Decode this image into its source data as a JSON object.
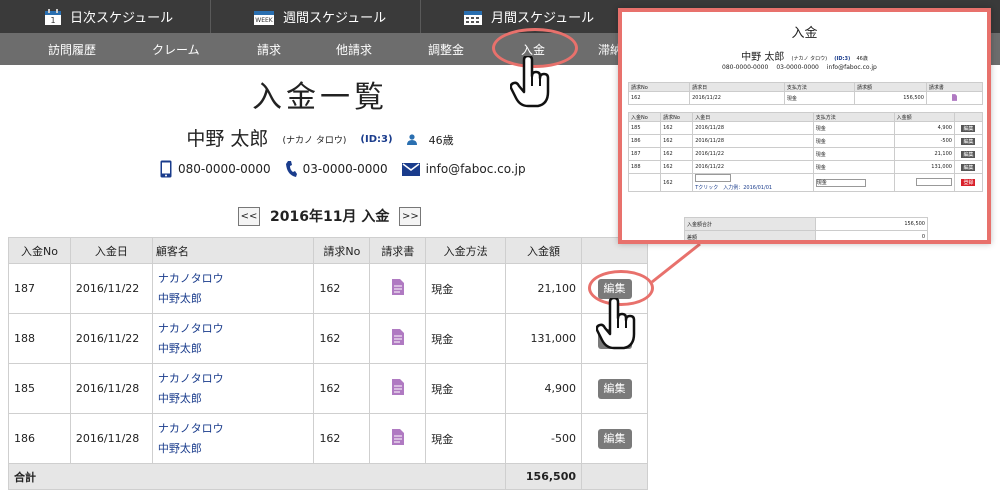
{
  "topbar": {
    "daily": "日次スケジュール",
    "weekly": "週間スケジュール",
    "monthly": "月間スケジュール",
    "weekly_icon_text": "WEEK",
    "daily_icon_text": "1"
  },
  "subnav": [
    "訪問履歴",
    "クレーム",
    "請求",
    "他請求",
    "調整金",
    "入金",
    "滞納"
  ],
  "page": {
    "title": "入金一覧",
    "name": "中野 太郎",
    "kana": "(ナカノ タロウ)",
    "id": "(ID:3)",
    "age": "46歳",
    "mobile": "080-0000-0000",
    "phone": "03-0000-0000",
    "email": "info@faboc.co.jp",
    "month": "2016年11月 入金",
    "prev": "<<",
    "next": ">>"
  },
  "table": {
    "headers": [
      "入金No",
      "入金日",
      "顧客名",
      "請求No",
      "請求書",
      "入金方法",
      "入金額",
      ""
    ],
    "rows": [
      {
        "no": "187",
        "date": "2016/11/22",
        "kana": "ナカノタロウ",
        "name": "中野太郎",
        "bill": "162",
        "method": "現金",
        "amount": "21,100",
        "edit": "編集"
      },
      {
        "no": "188",
        "date": "2016/11/22",
        "kana": "ナカノタロウ",
        "name": "中野太郎",
        "bill": "162",
        "method": "現金",
        "amount": "131,000",
        "edit": "編集"
      },
      {
        "no": "185",
        "date": "2016/11/28",
        "kana": "ナカノタロウ",
        "name": "中野太郎",
        "bill": "162",
        "method": "現金",
        "amount": "4,900",
        "edit": "編集"
      },
      {
        "no": "186",
        "date": "2016/11/28",
        "kana": "ナカノタロウ",
        "name": "中野太郎",
        "bill": "162",
        "method": "現金",
        "amount": "-500",
        "edit": "編集"
      }
    ],
    "total_label": "合計",
    "total_value": "156,500"
  },
  "inset": {
    "title": "入金",
    "name": "中野 太郎",
    "kana": "(ナカノ タロウ)",
    "id": "(ID:3)",
    "age": "46歳",
    "mobile": "080-0000-0000",
    "phone": "03-0000-0000",
    "email": "info@faboc.co.jp",
    "bill_headers": [
      "請求No",
      "請求日",
      "支払方法",
      "請求額",
      "請求書"
    ],
    "bill_row": {
      "no": "162",
      "date": "2016/11/22",
      "method": "現金",
      "amount": "156,500"
    },
    "pay_headers": [
      "入金No",
      "請求No",
      "入金日",
      "支払方法",
      "入金額",
      ""
    ],
    "pay_rows": [
      {
        "no": "185",
        "bill": "162",
        "date": "2016/11/28",
        "method": "現金",
        "amount": "4,900",
        "edit": "編集"
      },
      {
        "no": "186",
        "bill": "162",
        "date": "2016/11/28",
        "method": "現金",
        "amount": "-500",
        "edit": "編集"
      },
      {
        "no": "187",
        "bill": "162",
        "date": "2016/11/22",
        "method": "現金",
        "amount": "21,100",
        "edit": "編集"
      },
      {
        "no": "188",
        "bill": "162",
        "date": "2016/11/22",
        "method": "現金",
        "amount": "131,000",
        "edit": "編集"
      }
    ],
    "new_row": {
      "bill": "162",
      "hint": "Tクリック　入力例：2016/01/01",
      "method": "現金",
      "save": "登録"
    },
    "summary_total_label": "入金額合計",
    "summary_total_value": "156,500",
    "summary_diff_label": "差額",
    "summary_diff_value": "0"
  },
  "colors": {
    "highlight": "#e8716c",
    "topbar": "#3a3a3a",
    "subnav": "#6d6d6d",
    "link": "#1a3c8c",
    "doc_icon": "#9b59b6"
  }
}
